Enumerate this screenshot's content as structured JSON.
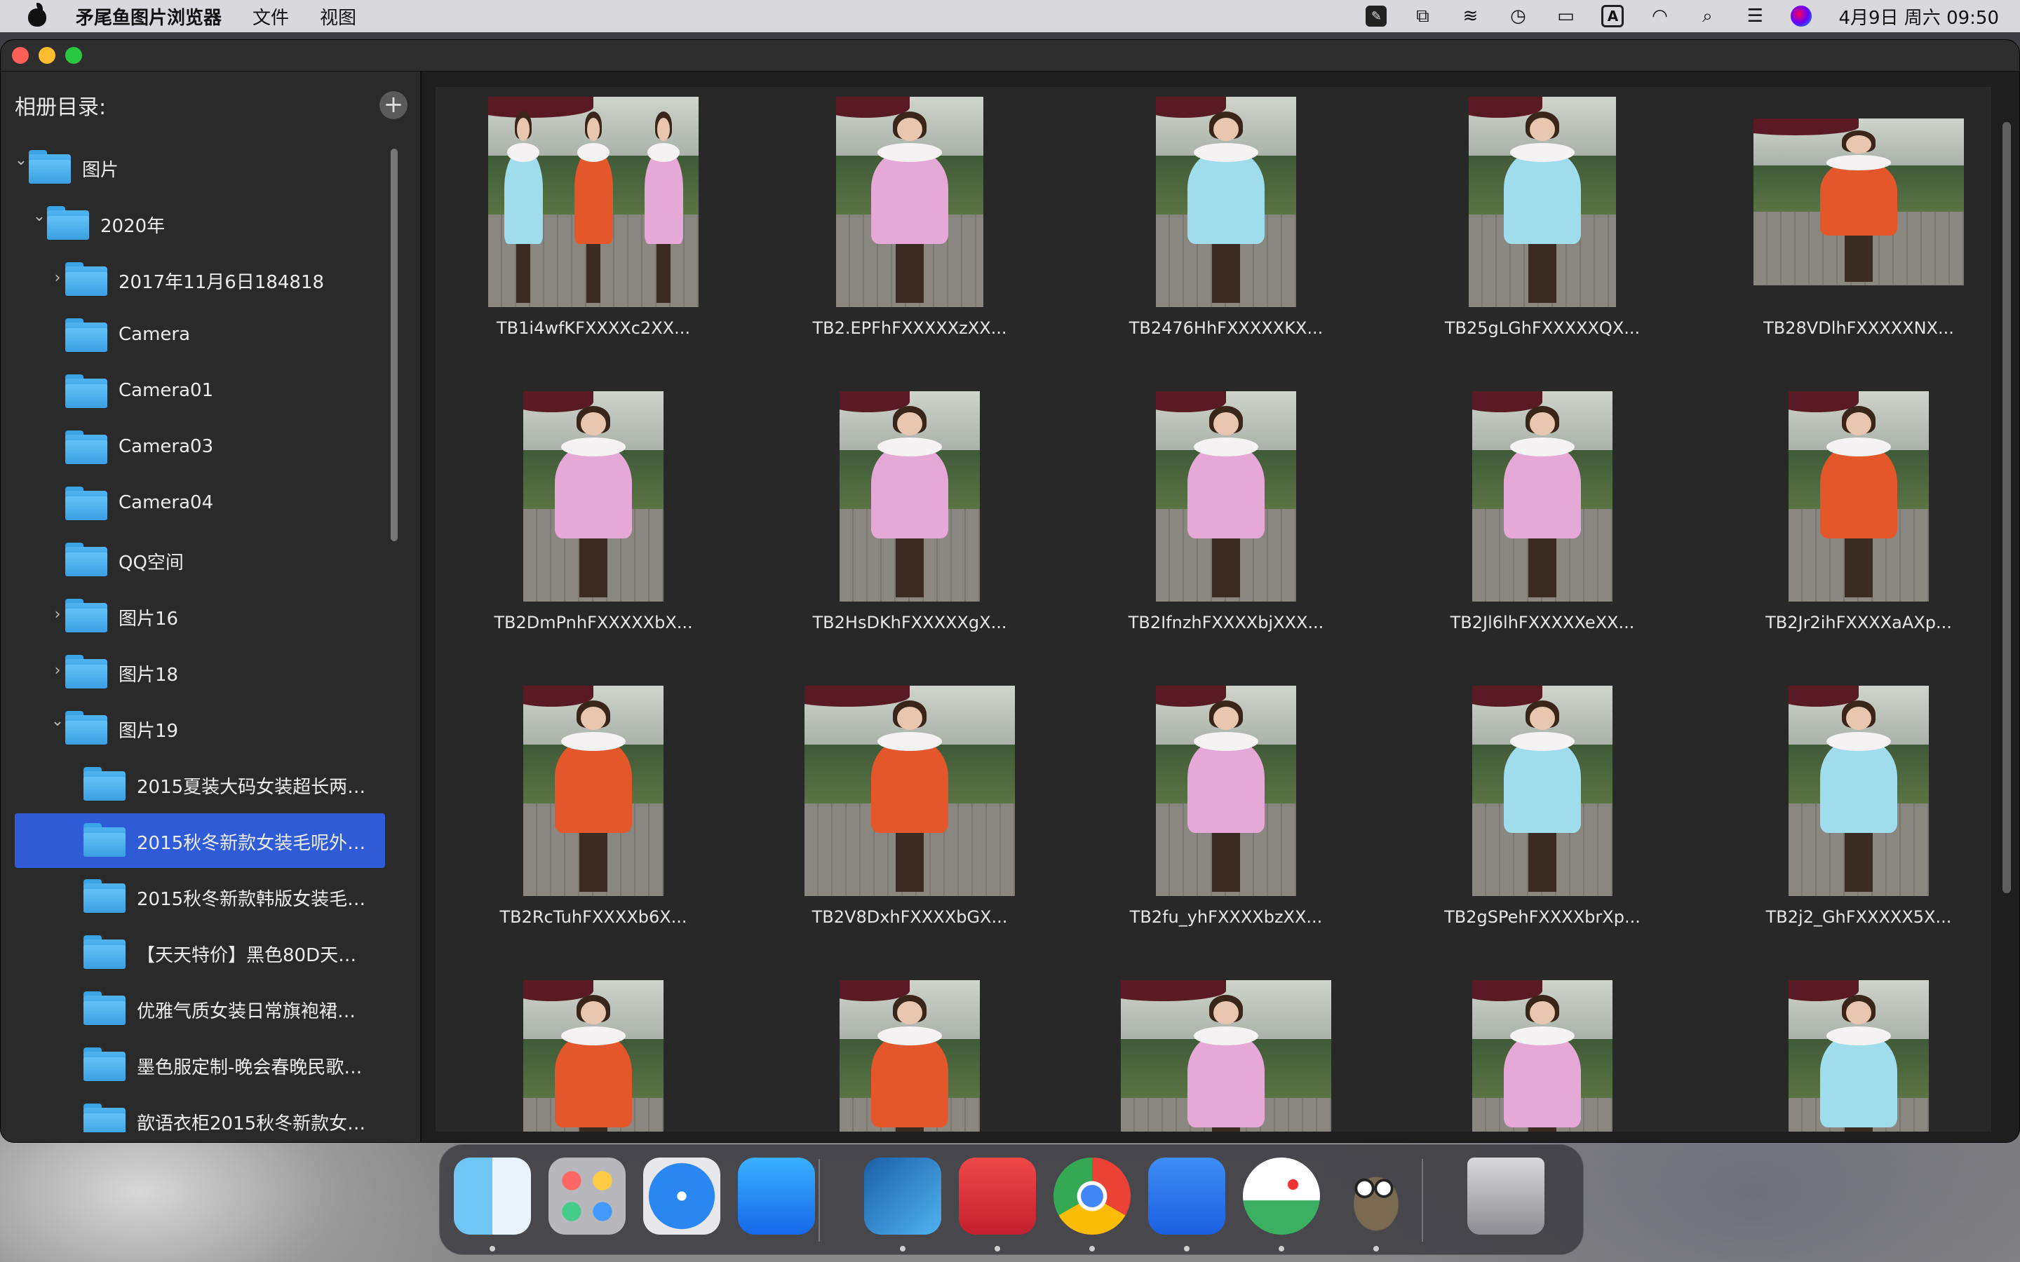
{
  "menubar": {
    "app_name": "矛尾鱼图片浏览器",
    "menus": [
      "文件",
      "视图"
    ],
    "input_method": "A",
    "clock": "4月9日 周六 09:50"
  },
  "sidebar": {
    "title": "相册目录:",
    "add_label": "+",
    "items": [
      {
        "label": "图片",
        "level": 0,
        "expanded": true,
        "has_children": true,
        "selected": false
      },
      {
        "label": "2020年",
        "level": 1,
        "expanded": true,
        "has_children": true,
        "selected": false
      },
      {
        "label": "2017年11月6日184818",
        "level": 2,
        "expanded": false,
        "has_children": true,
        "selected": false
      },
      {
        "label": "Camera",
        "level": 2,
        "expanded": false,
        "has_children": false,
        "selected": false
      },
      {
        "label": "Camera01",
        "level": 2,
        "expanded": false,
        "has_children": false,
        "selected": false
      },
      {
        "label": "Camera03",
        "level": 2,
        "expanded": false,
        "has_children": false,
        "selected": false
      },
      {
        "label": "Camera04",
        "level": 2,
        "expanded": false,
        "has_children": false,
        "selected": false
      },
      {
        "label": "QQ空间",
        "level": 2,
        "expanded": false,
        "has_children": false,
        "selected": false
      },
      {
        "label": "图片16",
        "level": 2,
        "expanded": false,
        "has_children": true,
        "selected": false
      },
      {
        "label": "图片18",
        "level": 2,
        "expanded": false,
        "has_children": true,
        "selected": false
      },
      {
        "label": "图片19",
        "level": 2,
        "expanded": true,
        "has_children": true,
        "selected": false
      },
      {
        "label": "2015夏装大码女装超长两…",
        "level": 3,
        "expanded": false,
        "has_children": false,
        "selected": false
      },
      {
        "label": "2015秋冬新款女装毛呢外…",
        "level": 3,
        "expanded": false,
        "has_children": false,
        "selected": true
      },
      {
        "label": "2015秋冬新款韩版女装毛…",
        "level": 3,
        "expanded": false,
        "has_children": false,
        "selected": false
      },
      {
        "label": "【天天特价】黑色80D天…",
        "level": 3,
        "expanded": false,
        "has_children": false,
        "selected": false
      },
      {
        "label": "优雅气质女装日常旗袍裙…",
        "level": 3,
        "expanded": false,
        "has_children": false,
        "selected": false
      },
      {
        "label": "墨色服定制-晚会春晚民歌…",
        "level": 3,
        "expanded": false,
        "has_children": false,
        "selected": false
      },
      {
        "label": "歆语衣柜2015秋冬新款女…",
        "level": 3,
        "expanded": false,
        "has_children": false,
        "selected": false
      }
    ]
  },
  "colors": {
    "selection": "#2f5cd6",
    "orange_coat": "#e4572a",
    "pink_coat": "#e6a8d6",
    "blue_coat": "#9fdcec"
  },
  "photos": [
    {
      "caption": "TB1i4wfKFXXXXc2XX...",
      "coat": "multi",
      "orient": "landscape"
    },
    {
      "caption": "TB2.EPFhFXXXXXzXX...",
      "coat": "pink",
      "orient": "landscape"
    },
    {
      "caption": "TB2476HhFXXXXXKX...",
      "coat": "blue",
      "orient": "portrait"
    },
    {
      "caption": "TB25gLGhFXXXXXQX...",
      "coat": "blue",
      "orient": "portrait"
    },
    {
      "caption": "TB28VDlhFXXXXXNX...",
      "coat": "orange",
      "orient": "wide"
    },
    {
      "caption": "TB2DmPnhFXXXXXbX...",
      "coat": "pink",
      "orient": "portrait"
    },
    {
      "caption": "TB2HsDKhFXXXXXgX...",
      "coat": "pink",
      "orient": "portrait"
    },
    {
      "caption": "TB2IfnzhFXXXXbjXXX...",
      "coat": "pink",
      "orient": "portrait"
    },
    {
      "caption": "TB2Jl6lhFXXXXXeXX...",
      "coat": "pink",
      "orient": "portrait"
    },
    {
      "caption": "TB2Jr2ihFXXXXaAXp...",
      "coat": "orange",
      "orient": "portrait"
    },
    {
      "caption": "TB2RcTuhFXXXXb6X...",
      "coat": "orange",
      "orient": "portrait"
    },
    {
      "caption": "TB2V8DxhFXXXXbGX...",
      "coat": "orange",
      "orient": "landscape"
    },
    {
      "caption": "TB2fu_yhFXXXXbzXX...",
      "coat": "pink",
      "orient": "portrait"
    },
    {
      "caption": "TB2gSPehFXXXXbrXp...",
      "coat": "blue",
      "orient": "portrait"
    },
    {
      "caption": "TB2j2_GhFXXXXX5X...",
      "coat": "blue",
      "orient": "portrait"
    },
    {
      "caption": "",
      "coat": "orange",
      "orient": "portrait"
    },
    {
      "caption": "",
      "coat": "orange",
      "orient": "portrait"
    },
    {
      "caption": "",
      "coat": "pink",
      "orient": "landscape"
    },
    {
      "caption": "",
      "coat": "pink",
      "orient": "portrait"
    },
    {
      "caption": "",
      "coat": "blue",
      "orient": "portrait"
    }
  ],
  "dock": {
    "apps": [
      {
        "icon": "finder-icon",
        "running": true
      },
      {
        "icon": "launchpad-icon",
        "running": false
      },
      {
        "icon": "safari-icon",
        "running": false
      },
      {
        "icon": "app-store-icon",
        "running": false
      },
      {
        "icon": "forward-arrow-app-icon",
        "running": true
      },
      {
        "icon": "red-app-icon",
        "running": true
      },
      {
        "icon": "chrome-icon",
        "running": true
      },
      {
        "icon": "pencil-app-icon",
        "running": true
      },
      {
        "icon": "preview-image-icon",
        "running": true
      },
      {
        "icon": "gimp-icon",
        "running": true
      },
      {
        "icon": "trash-icon",
        "running": false
      }
    ]
  }
}
